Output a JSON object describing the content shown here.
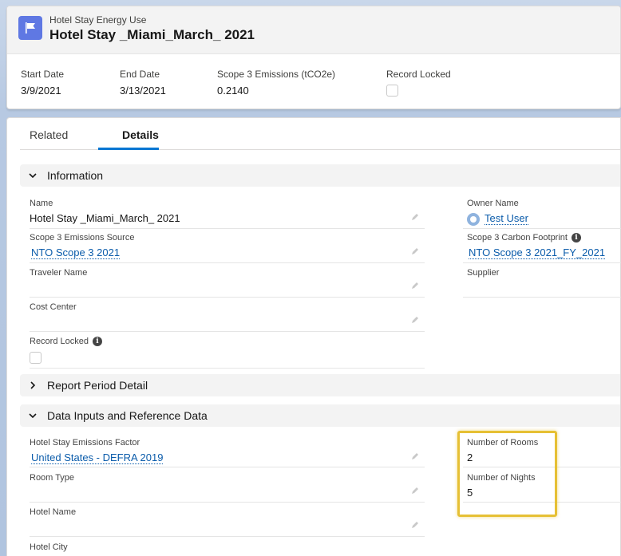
{
  "header": {
    "object_label": "Hotel Stay Energy Use",
    "record_title": "Hotel Stay _Miami_March_ 2021",
    "fields": [
      {
        "label": "Start Date",
        "value": "3/9/2021"
      },
      {
        "label": "End Date",
        "value": "3/13/2021"
      },
      {
        "label": "Scope 3 Emissions (tCO2e)",
        "value": "0.2140"
      },
      {
        "label": "Record Locked",
        "value": ""
      }
    ],
    "icon": "flag-icon",
    "accent_color": "#5f78e3"
  },
  "tabs": [
    {
      "label": "Related"
    },
    {
      "label": "Details"
    }
  ],
  "sections": {
    "information": {
      "title": "Information",
      "name_label": "Name",
      "name_value": "Hotel Stay _Miami_March_ 2021",
      "owner_label": "Owner Name",
      "owner_value": "Test User",
      "source_label": "Scope 3 Emissions Source",
      "source_value": "NTO Scope 3 2021",
      "footprint_label": "Scope 3 Carbon Footprint",
      "footprint_value": "NTO Scope 3 2021_FY_2021",
      "traveler_label": "Traveler Name",
      "supplier_label": "Supplier",
      "cost_center_label": "Cost Center",
      "record_locked_label": "Record Locked"
    },
    "report_period": {
      "title": "Report Period Detail"
    },
    "data_inputs": {
      "title": "Data Inputs and Reference Data",
      "factor_label": "Hotel Stay Emissions Factor",
      "factor_value": "United States - DEFRA 2019",
      "rooms_label": "Number of Rooms",
      "rooms_value": "2",
      "room_type_label": "Room Type",
      "nights_label": "Number of Nights",
      "nights_value": "5",
      "hotel_name_label": "Hotel Name",
      "hotel_city_label": "Hotel City"
    }
  },
  "colors": {
    "link": "#0b5cab",
    "tab_active": "#0176d3",
    "highlight": "#e6c034"
  }
}
